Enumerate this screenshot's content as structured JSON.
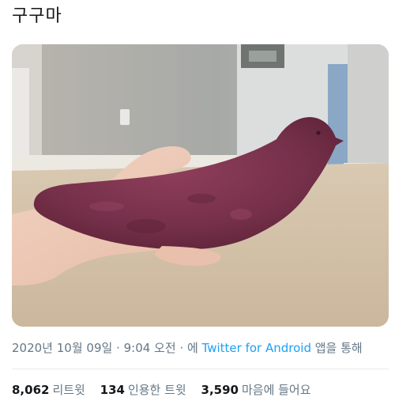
{
  "tweet": {
    "text": "구구마",
    "photo_alt_icon": "sweet-potato-pigeon-photo",
    "timestamp": {
      "date": "2020년 10월 09일",
      "sep1": " · ",
      "time": "9:04 오전",
      "sep2": " · 에 ",
      "source": "Twitter for Android",
      "suffix": " 앱을 통해"
    },
    "stats": [
      {
        "count": "8,062",
        "label": "리트윗"
      },
      {
        "count": "134",
        "label": "인용한 트윗"
      },
      {
        "count": "3,590",
        "label": "마음에 들어요"
      }
    ]
  },
  "colors": {
    "text": "#14171a",
    "secondary": "#657786",
    "link": "#1da1f2",
    "divider": "#e6ecf0"
  }
}
